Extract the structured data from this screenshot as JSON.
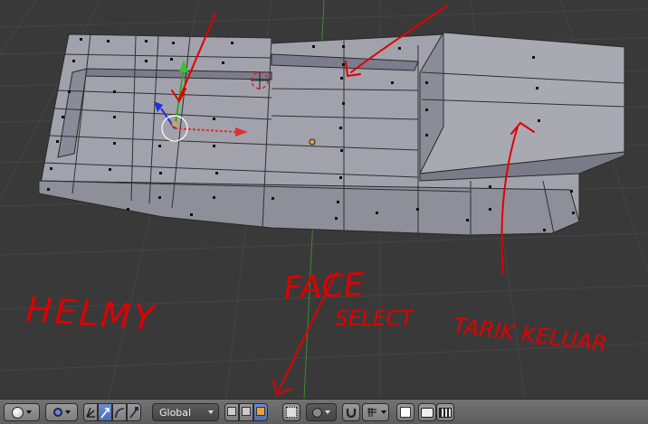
{
  "annotations": {
    "face": "FACE",
    "select": "SELECT",
    "tarik_keluar": "TARIK KELUAR",
    "author": "HELMY"
  },
  "header": {
    "transform_orientation": "Global",
    "icons": [
      "viewport-shading-icon",
      "pivot-point-icon",
      "manipulator-toggle-icon",
      "translate-icon",
      "rotate-icon",
      "scale-icon",
      "vertex-select-icon",
      "edge-select-icon",
      "face-select-icon",
      "occlude-geometry-icon",
      "proportional-edit-icon",
      "snap-icon",
      "snap-element-icon",
      "render-image-icon",
      "render-anim-icon"
    ]
  },
  "colors": {
    "viewport_bg": "#393939",
    "mesh_face": "#a3a3ab",
    "annotation": "#e00000",
    "x_axis": "#d03030",
    "y_axis": "#3a9a2a",
    "z_axis": "#2030e0"
  }
}
